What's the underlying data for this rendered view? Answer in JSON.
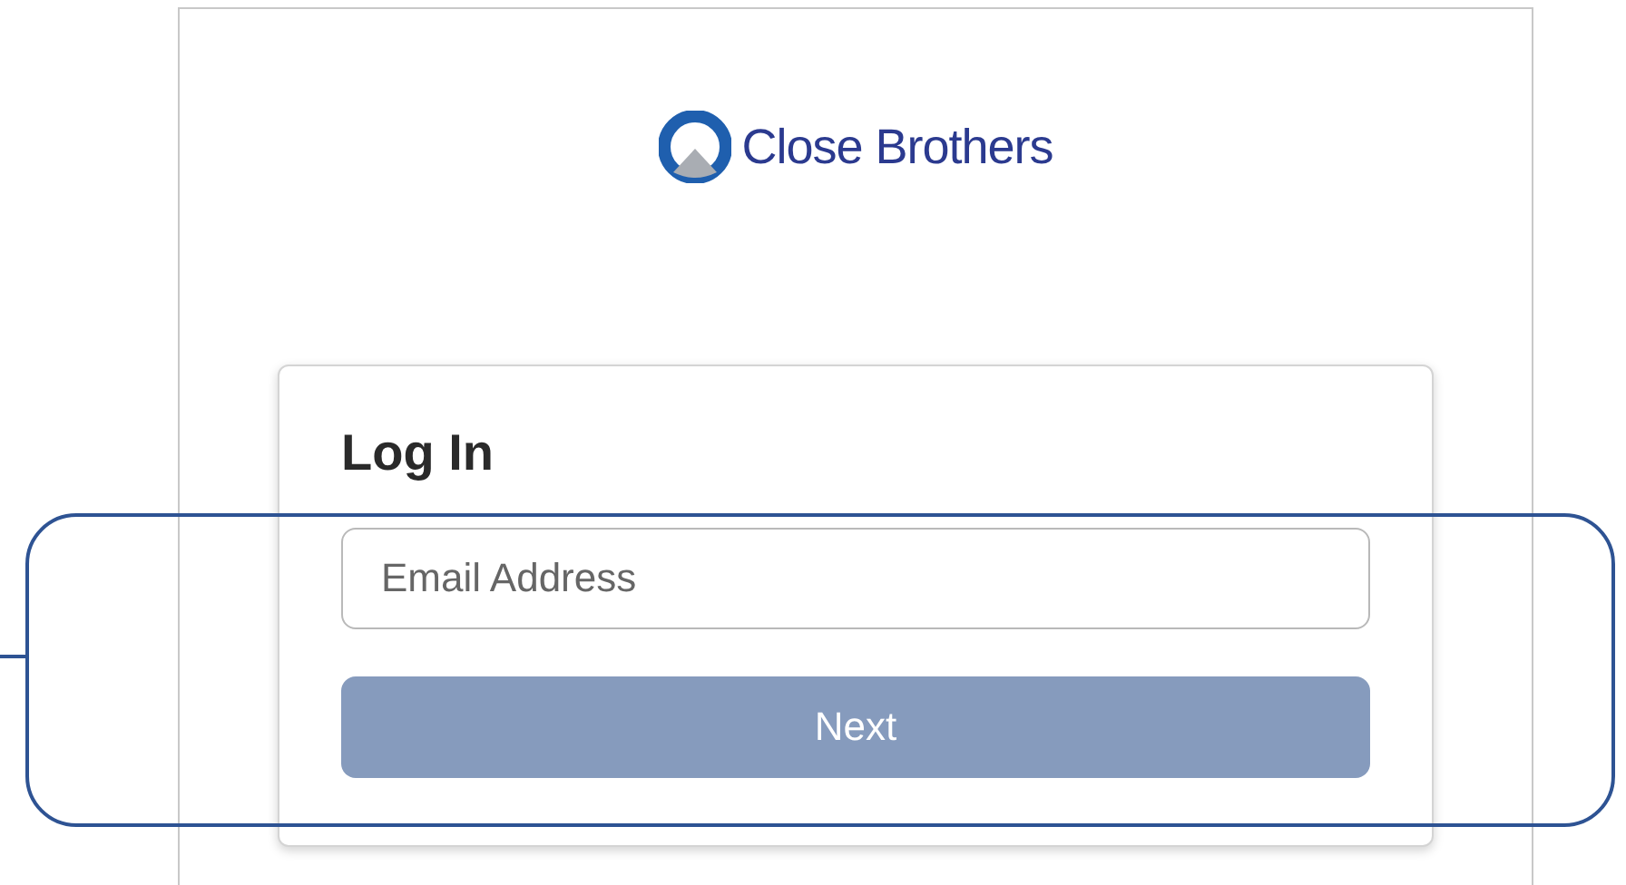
{
  "logo": {
    "text": "Close Brothers"
  },
  "login": {
    "title": "Log In",
    "email": {
      "placeholder": "Email Address"
    },
    "next_button": {
      "label": "Next",
      "disabled": true
    }
  }
}
